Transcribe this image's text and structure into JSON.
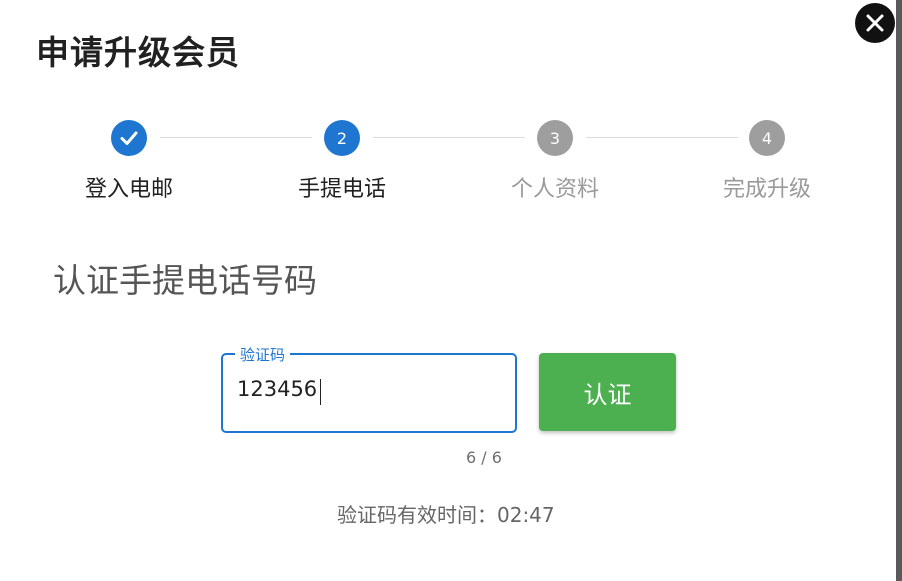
{
  "dialog": {
    "title": "申请升级会员",
    "close_icon": "close-icon"
  },
  "stepper": {
    "steps": [
      {
        "label": "登入电邮",
        "marker": "✓",
        "state": "completed"
      },
      {
        "label": "手提电话",
        "marker": "2",
        "state": "current"
      },
      {
        "label": "个人资料",
        "marker": "3",
        "state": "pending"
      },
      {
        "label": "完成升级",
        "marker": "4",
        "state": "pending"
      }
    ]
  },
  "main": {
    "heading": "认证手提电话号码",
    "code_field": {
      "label": "验证码",
      "value": "123456",
      "counter": "6 / 6"
    },
    "verify_button": "认证",
    "validity_label": "验证码有效时间：02:47"
  },
  "colors": {
    "primary": "#1f76d1",
    "success": "#4caf50",
    "inactive": "#9e9e9e"
  }
}
